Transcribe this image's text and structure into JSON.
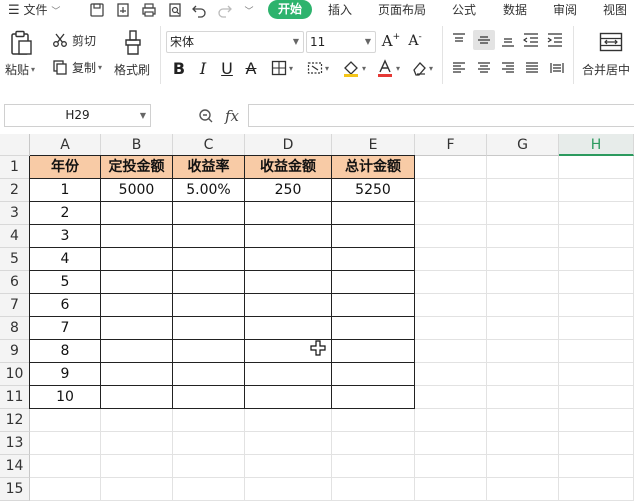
{
  "menubar": {
    "file_label": "文件",
    "tabs": [
      "开始",
      "插入",
      "页面布局",
      "公式",
      "数据",
      "审阅",
      "视图"
    ],
    "accent": "#2db36d"
  },
  "ribbon": {
    "paste": "粘贴",
    "cut": "剪切",
    "copy": "复制",
    "format_painter": "格式刷",
    "font_name": "宋体",
    "font_size": "11",
    "merge_center": "合并居中"
  },
  "formula_bar": {
    "name_box": "H29",
    "fx": "fx",
    "content": ""
  },
  "sheet": {
    "columns": [
      "A",
      "B",
      "C",
      "D",
      "E",
      "F",
      "G",
      "H"
    ],
    "selected_column": "H",
    "rows": [
      "1",
      "2",
      "3",
      "4",
      "5",
      "6",
      "7",
      "8",
      "9",
      "10",
      "11",
      "12",
      "13",
      "14",
      "15"
    ],
    "table": {
      "header": [
        "年份",
        "定投金额",
        "收益率",
        "收益金额",
        "总计金额"
      ],
      "header_color": "#f8cba6",
      "body": [
        [
          "1",
          "5000",
          "5.00%",
          "250",
          "5250"
        ],
        [
          "2",
          "",
          "",
          "",
          ""
        ],
        [
          "3",
          "",
          "",
          "",
          ""
        ],
        [
          "4",
          "",
          "",
          "",
          ""
        ],
        [
          "5",
          "",
          "",
          "",
          ""
        ],
        [
          "6",
          "",
          "",
          "",
          ""
        ],
        [
          "7",
          "",
          "",
          "",
          ""
        ],
        [
          "8",
          "",
          "",
          "",
          ""
        ],
        [
          "9",
          "",
          "",
          "",
          ""
        ],
        [
          "10",
          "",
          "",
          "",
          ""
        ]
      ]
    }
  }
}
